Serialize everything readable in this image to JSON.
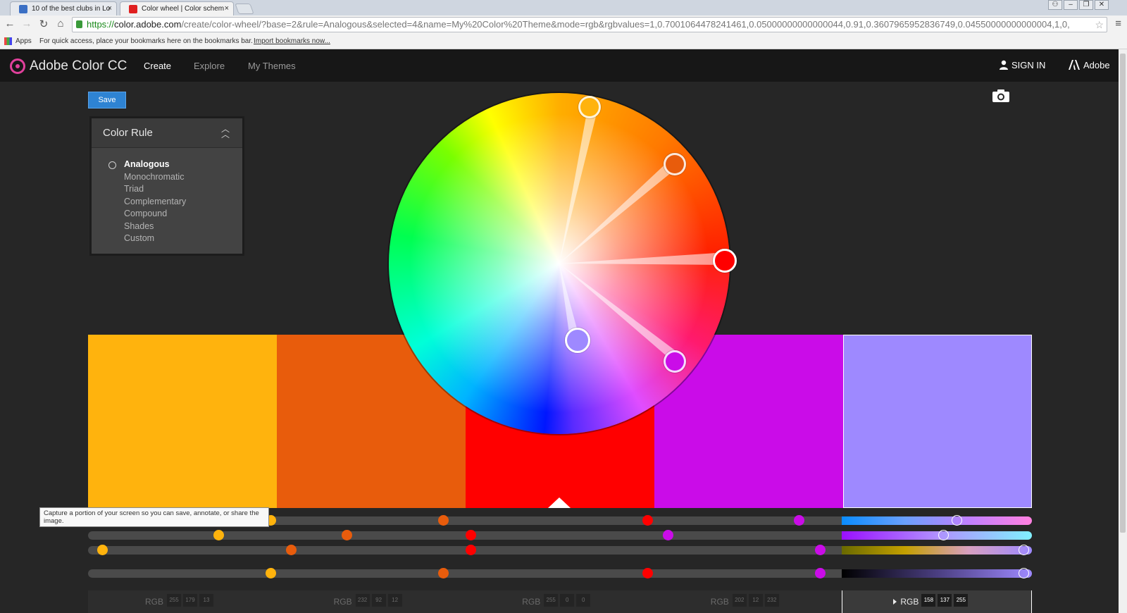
{
  "browser": {
    "tabs": [
      {
        "label": "10 of the best clubs in Lo",
        "active": false
      },
      {
        "label": "Color wheel | Color schem",
        "active": true
      }
    ],
    "url": {
      "scheme": "https://",
      "host": "color.adobe.com",
      "rest": "/create/color-wheel/?base=2&rule=Analogous&selected=4&name=My%20Color%20Theme&mode=rgb&rgbvalues=1,0.7001064478241461,0.05000000000000044,0.91,0.3607965952836749,0.04550000000000004,1,0,"
    },
    "bookmarks": {
      "apps_label": "Apps",
      "hint": "For quick access, place your bookmarks here on the bookmarks bar.",
      "import_label": "Import bookmarks now..."
    }
  },
  "header": {
    "brand": "Adobe Color CC",
    "nav": [
      {
        "label": "Create",
        "active": true
      },
      {
        "label": "Explore",
        "active": false
      },
      {
        "label": "My Themes",
        "active": false
      }
    ],
    "sign_in": "SIGN IN",
    "adobe": "Adobe"
  },
  "save_label": "Save",
  "color_rule": {
    "title": "Color Rule",
    "selected": "Analogous",
    "rules": [
      "Analogous",
      "Monochromatic",
      "Triad",
      "Complementary",
      "Compound",
      "Shades",
      "Custom"
    ]
  },
  "swatches": [
    {
      "hex": "#FFB30D",
      "rgb": [
        255,
        179,
        13
      ],
      "selected": false
    },
    {
      "hex": "#E85C0C",
      "rgb": [
        232,
        92,
        12
      ],
      "selected": false
    },
    {
      "hex": "#FF0000",
      "rgb": [
        255,
        0,
        0
      ],
      "selected": false
    },
    {
      "hex": "#CA0CE8",
      "rgb": [
        202,
        12,
        232
      ],
      "selected": false
    },
    {
      "hex": "#9E89FF",
      "rgb": [
        158,
        137,
        255
      ],
      "selected": true
    }
  ],
  "rgb_mode_label": "RGB",
  "tooltip": "Capture a portion of your screen so you can save, annotate, or share the image.",
  "icons": [
    "user-icon",
    "adobe-icon",
    "camera-icon",
    "radio-icon",
    "chevron-up-icon",
    "triangle-right-icon"
  ]
}
